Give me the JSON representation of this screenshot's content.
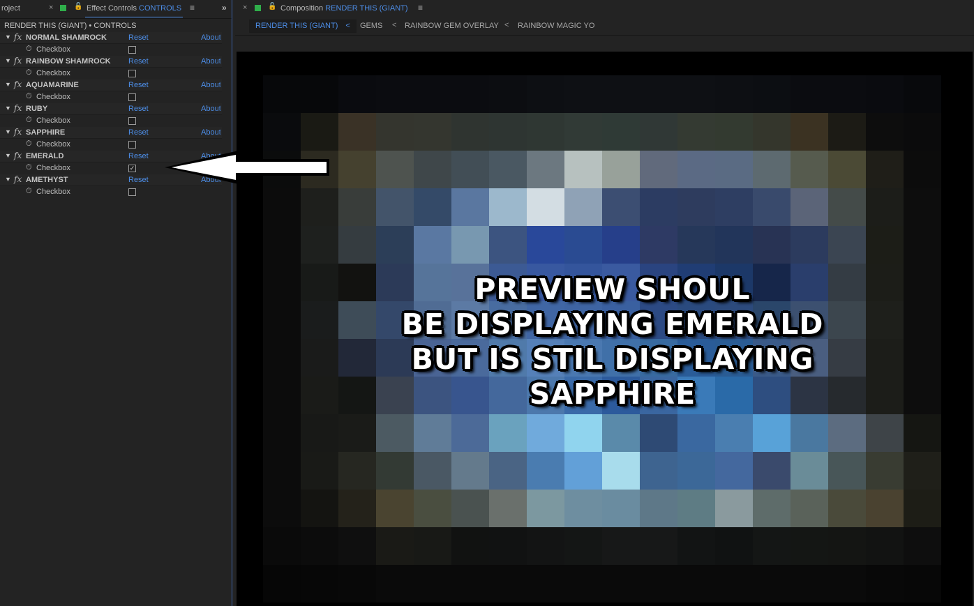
{
  "left_tabs": {
    "project_label": "roject",
    "effect_controls_label": "Effect Controls",
    "effect_controls_target": "CONTROLS",
    "close_glyph": "×",
    "menu_glyph": "≡",
    "overflow_glyph": "»"
  },
  "breadcrumb_left": "RENDER THIS  (GIANT) • CONTROLS",
  "effects": [
    {
      "name": "NORMAL SHAMROCK",
      "reset": "Reset",
      "about": "About",
      "checkbox_label": "Checkbox",
      "checked": false
    },
    {
      "name": "RAINBOW SHAMROCK",
      "reset": "Reset",
      "about": "About",
      "checkbox_label": "Checkbox",
      "checked": false
    },
    {
      "name": "AQUAMARINE",
      "reset": "Reset",
      "about": "About",
      "checkbox_label": "Checkbox",
      "checked": false
    },
    {
      "name": "RUBY",
      "reset": "Reset",
      "about": "About",
      "checkbox_label": "Checkbox",
      "checked": false
    },
    {
      "name": "SAPPHIRE",
      "reset": "Reset",
      "about": "About",
      "checkbox_label": "Checkbox",
      "checked": false
    },
    {
      "name": "EMERALD",
      "reset": "Reset",
      "about": "About",
      "checkbox_label": "Checkbox",
      "checked": true
    },
    {
      "name": "AMETHYST",
      "reset": "Reset",
      "about": "About",
      "checkbox_label": "Checkbox",
      "checked": false
    }
  ],
  "fx_glyph": "fx",
  "composition": {
    "prefix": "Composition",
    "name": "RENDER THIS  (GIANT)",
    "menu_glyph": "≡",
    "close_glyph": "×"
  },
  "flow": {
    "active": "RENDER THIS  (GIANT)",
    "items": [
      "GEMS",
      "RAINBOW GEM OVERLAY",
      "RAINBOW MAGIC YO"
    ],
    "chevron": "<"
  },
  "overlay": {
    "lines": [
      "PREVIEW SHOUL",
      "BE DISPLAYING EMERALD",
      "BUT IS STIL DISPLAYING",
      "SAPPHIRE"
    ]
  },
  "colors": {
    "accent": "#4d8ee8",
    "panel_bg": "#232323",
    "viewer_bg": "#000000",
    "label_green": "#2fae4a"
  }
}
